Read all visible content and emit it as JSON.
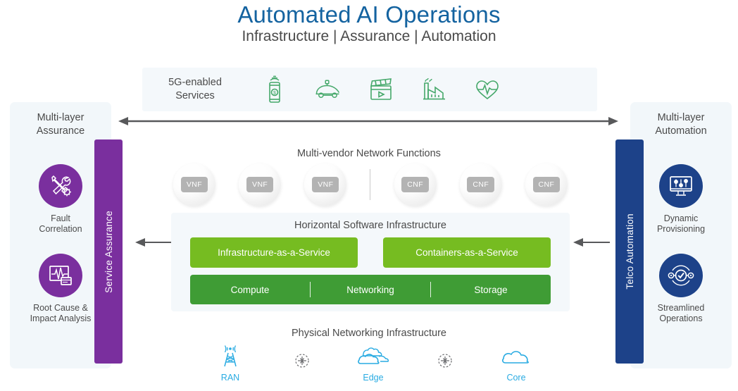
{
  "header": {
    "title": "Automated AI Operations",
    "subtitle": "Infrastructure | Assurance | Automation",
    "title_color": "#1463a0",
    "subtitle_color": "#4a4a4a"
  },
  "services": {
    "label": "5G-enabled\nServices",
    "label_line1": "5G-enabled",
    "label_line2": "Services",
    "accent_color": "#45a86a",
    "icons": [
      {
        "name": "mobile-payment-icon",
        "title": "5G mobile payment"
      },
      {
        "name": "autonomous-car-icon",
        "title": "Connected vehicle"
      },
      {
        "name": "media-clapperboard-icon",
        "title": "Media and entertainment"
      },
      {
        "name": "factory-icon",
        "title": "Industry 4.0"
      },
      {
        "name": "healthcare-heart-icon",
        "title": "Connected healthcare"
      }
    ]
  },
  "left_panel": {
    "title_line1": "Multi-layer",
    "title_line2": "Assurance",
    "accent_color": "#7a2f9e",
    "vertical_bar_label": "Service Assurance",
    "badges": [
      {
        "icon": "wrench-gear-icon",
        "caption_line1": "Fault",
        "caption_line2": "Correlation"
      },
      {
        "icon": "monitor-waveform-icon",
        "caption_line1": "Root Cause &",
        "caption_line2": "Impact Analysis"
      }
    ]
  },
  "right_panel": {
    "title_line1": "Multi-layer",
    "title_line2": "Automation",
    "accent_color": "#1d4289",
    "vertical_bar_label": "Telco Automation",
    "badges": [
      {
        "icon": "monitor-sliders-icon",
        "caption_line1": "Dynamic",
        "caption_line2": "Provisioning"
      },
      {
        "icon": "check-orbit-icon",
        "caption_line1": "Streamlined",
        "caption_line2": "Operations"
      }
    ]
  },
  "network_functions": {
    "title": "Multi-vendor Network Functions",
    "tag_color": "#b3b3b3",
    "items": [
      {
        "label": "VNF"
      },
      {
        "label": "VNF"
      },
      {
        "label": "VNF"
      },
      {
        "label": "CNF"
      },
      {
        "label": "CNF"
      },
      {
        "label": "CNF"
      }
    ]
  },
  "software_infrastructure": {
    "title": "Horizontal Software Infrastructure",
    "light_green": "#76bc21",
    "dark_green": "#3f9c35",
    "service_boxes": [
      {
        "label": "Infrastructure-as-a-Service"
      },
      {
        "label": "Containers-as-a-Service"
      }
    ],
    "resource_bar": [
      {
        "label": "Compute"
      },
      {
        "label": "Networking"
      },
      {
        "label": "Storage"
      }
    ]
  },
  "physical_infrastructure": {
    "title": "Physical Networking Infrastructure",
    "label_color": "#29abe2",
    "nodes": [
      {
        "label": "RAN",
        "icon": "cell-tower-icon"
      },
      {
        "label": "",
        "icon": "network-node-icon"
      },
      {
        "label": "Edge",
        "icon": "cloud-cluster-icon"
      },
      {
        "label": "",
        "icon": "network-node-icon"
      },
      {
        "label": "Core",
        "icon": "cloud-icon"
      }
    ]
  },
  "arrows": {
    "main": "bidirectional-arrow",
    "left_inner": "left-arrow",
    "right_inner": "left-arrow",
    "color": "#58595b"
  }
}
